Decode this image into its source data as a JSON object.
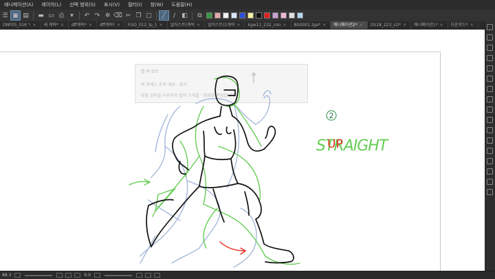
{
  "menu": [
    "애니메이션(A)",
    "레이어(L)",
    "선택 범위(S)",
    "표시(V)",
    "필터(I)",
    "창(W)",
    "도움말(H)"
  ],
  "toolbar": {
    "colors": [
      "#3a9a44",
      "#e8a8a8",
      "#f0f0f0",
      "#d8e8f8",
      "#2b4fd8",
      "#f4f0a0",
      "#111111",
      "#e02020",
      "#c9a0d8",
      "#f0b8d8",
      "#e0e0e0",
      "#b0d8f0"
    ]
  },
  "tabs": [
    {
      "label": "ONP25_016ㄱ",
      "active": false
    },
    {
      "label": "새 캐릭*",
      "active": false
    },
    {
      "label": "dff캐릭*",
      "active": false
    },
    {
      "label": "dff캐릭*",
      "active": false
    },
    {
      "label": "FGO_012_lp_1",
      "active": false
    },
    {
      "label": "일러스트(캐릭",
      "active": false
    },
    {
      "label": "일러스트(1캐릭",
      "active": false
    },
    {
      "label": "kgw11_232_con",
      "active": false
    },
    {
      "label": "BG0001.tga*",
      "active": false
    },
    {
      "label": "애니메이션2*",
      "active": true
    },
    {
      "label": "OS18_223_LO*",
      "active": false
    },
    {
      "label": "애니메이션1*",
      "active": false
    },
    {
      "label": "다운로드*",
      "active": false
    }
  ],
  "dialog": {
    "title": "탭 속 보조",
    "line1": "퀵 액세스    조작 대상     ·     표시",
    "line2": "대표 입력을 사용하여 탭의 조작을 · 정점을 편집합니다"
  },
  "annotations": {
    "number": "2",
    "word_up": "UP",
    "word_straight": "STRAIGHT"
  },
  "statusbar": {
    "zoom": "88.3",
    "angle": "0.0"
  }
}
